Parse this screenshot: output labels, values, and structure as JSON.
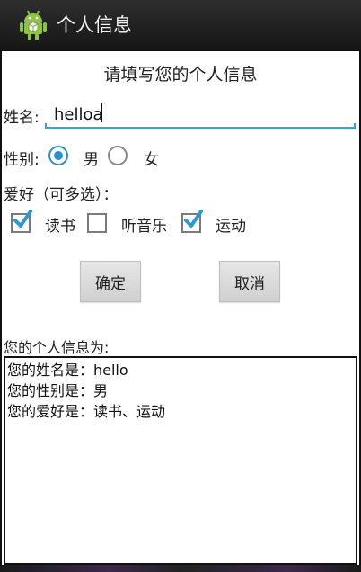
{
  "app": {
    "title": "个人信息"
  },
  "form": {
    "heading": "请填写您的个人信息",
    "name_label": "姓名:",
    "name_value": "helloa",
    "gender_label": "性别:",
    "gender_options": [
      "男",
      "女"
    ],
    "gender_selected": "男",
    "hobby_label": "爱好（可多选）：",
    "hobbies": [
      {
        "label": "读书",
        "checked": true
      },
      {
        "label": "听音乐",
        "checked": false
      },
      {
        "label": "运动",
        "checked": true
      }
    ],
    "confirm_label": "确定",
    "cancel_label": "取消"
  },
  "result": {
    "label": "您的个人信息为:",
    "lines": [
      "您的姓名是：hello",
      "您的性别是：男",
      "您的爱好是：读书、运动"
    ]
  },
  "colors": {
    "accent": "#33a6d8",
    "radio": "#2f8fc9",
    "check": "#2c98d4",
    "titlebar": "#1c1c1c"
  }
}
